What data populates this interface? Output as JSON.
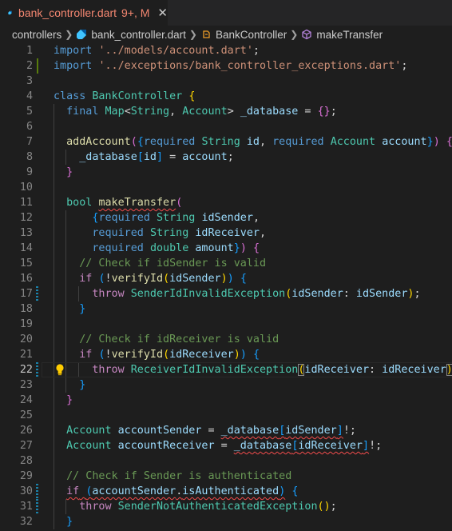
{
  "tab": {
    "filename": "bank_controller.dart",
    "badge": "9+, M",
    "close_glyph": "✕"
  },
  "breadcrumb": {
    "folder": "controllers",
    "file": "bank_controller.dart",
    "class": "BankController",
    "method": "makeTransfer"
  },
  "colors": {
    "tab_modified": "#f48771",
    "line_added": "#587c0c",
    "line_modified": "#1b81a8",
    "error_squiggle": "#f14c4c"
  },
  "editor": {
    "line_numbers": [
      "1",
      "2",
      "3",
      "4",
      "5",
      "6",
      "7",
      "8",
      "9",
      "10",
      "11",
      "12",
      "13",
      "14",
      "15",
      "16",
      "17",
      "18",
      "19",
      "20",
      "21",
      "22",
      "23",
      "24",
      "25",
      "26",
      "27",
      "28",
      "29",
      "30",
      "31",
      "32"
    ],
    "active_line": "22",
    "lines": [
      [
        [
          "kw",
          "import"
        ],
        [
          "pn",
          " "
        ],
        [
          "st",
          "'../models/account.dart'"
        ],
        [
          "pn",
          ";"
        ]
      ],
      [
        [
          "kw",
          "import"
        ],
        [
          "pn",
          " "
        ],
        [
          "st",
          "'../exceptions/bank_controller_exceptions.dart'"
        ],
        [
          "pn",
          ";"
        ]
      ],
      [],
      [
        [
          "kw",
          "class"
        ],
        [
          "pn",
          " "
        ],
        [
          "ty",
          "BankController"
        ],
        [
          "pn",
          " "
        ],
        [
          "b1",
          "{"
        ]
      ],
      [
        [
          "pn",
          "  "
        ],
        [
          "kw",
          "final"
        ],
        [
          "pn",
          " "
        ],
        [
          "ty",
          "Map"
        ],
        [
          "pn",
          "<"
        ],
        [
          "ty",
          "String"
        ],
        [
          "pn",
          ", "
        ],
        [
          "ty",
          "Account"
        ],
        [
          "pn",
          "> "
        ],
        [
          "vr",
          "_database"
        ],
        [
          "pn",
          " = "
        ],
        [
          "b2",
          "{}"
        ],
        [
          "pn",
          ";"
        ]
      ],
      [],
      [
        [
          "pn",
          "  "
        ],
        [
          "fn",
          "addAccount"
        ],
        [
          "b2",
          "("
        ],
        [
          "b3",
          "{"
        ],
        [
          "kw",
          "required"
        ],
        [
          "pn",
          " "
        ],
        [
          "ty",
          "String"
        ],
        [
          "pn",
          " "
        ],
        [
          "vr",
          "id"
        ],
        [
          "pn",
          ", "
        ],
        [
          "kw",
          "required"
        ],
        [
          "pn",
          " "
        ],
        [
          "ty",
          "Account"
        ],
        [
          "pn",
          " "
        ],
        [
          "vr",
          "account"
        ],
        [
          "b3",
          "}"
        ],
        [
          "b2",
          ")"
        ],
        [
          "pn",
          " "
        ],
        [
          "b2",
          "{"
        ]
      ],
      [
        [
          "pn",
          "    "
        ],
        [
          "vr",
          "_database"
        ],
        [
          "b3",
          "["
        ],
        [
          "vr",
          "id"
        ],
        [
          "b3",
          "]"
        ],
        [
          "pn",
          " = "
        ],
        [
          "vr",
          "account"
        ],
        [
          "pn",
          ";"
        ]
      ],
      [
        [
          "pn",
          "  "
        ],
        [
          "b2",
          "}"
        ]
      ],
      [],
      [
        [
          "pn",
          "  "
        ],
        [
          "ty",
          "bool"
        ],
        [
          "pn",
          " "
        ],
        [
          "fn:sq",
          "makeTransfer"
        ],
        [
          "b2",
          "("
        ]
      ],
      [
        [
          "pn",
          "      "
        ],
        [
          "b3",
          "{"
        ],
        [
          "kw",
          "required"
        ],
        [
          "pn",
          " "
        ],
        [
          "ty",
          "String"
        ],
        [
          "pn",
          " "
        ],
        [
          "vr",
          "idSender"
        ],
        [
          "pn",
          ","
        ]
      ],
      [
        [
          "pn",
          "      "
        ],
        [
          "kw",
          "required"
        ],
        [
          "pn",
          " "
        ],
        [
          "ty",
          "String"
        ],
        [
          "pn",
          " "
        ],
        [
          "vr",
          "idReceiver"
        ],
        [
          "pn",
          ","
        ]
      ],
      [
        [
          "pn",
          "      "
        ],
        [
          "kw",
          "required"
        ],
        [
          "pn",
          " "
        ],
        [
          "ty",
          "double"
        ],
        [
          "pn",
          " "
        ],
        [
          "vr",
          "amount"
        ],
        [
          "b3",
          "}"
        ],
        [
          "b2",
          ")"
        ],
        [
          "pn",
          " "
        ],
        [
          "b2",
          "{"
        ]
      ],
      [
        [
          "pn",
          "    "
        ],
        [
          "cm",
          "// Check if idSender is valid"
        ]
      ],
      [
        [
          "pn",
          "    "
        ],
        [
          "ct",
          "if"
        ],
        [
          "pn",
          " "
        ],
        [
          "b3",
          "("
        ],
        [
          "pn",
          "!"
        ],
        [
          "fn",
          "verifyId"
        ],
        [
          "b1",
          "("
        ],
        [
          "vr",
          "idSender"
        ],
        [
          "b1",
          ")"
        ],
        [
          "b3",
          ")"
        ],
        [
          "pn",
          " "
        ],
        [
          "b3",
          "{"
        ]
      ],
      [
        [
          "pn",
          "      "
        ],
        [
          "ct",
          "throw"
        ],
        [
          "pn",
          " "
        ],
        [
          "ty",
          "SenderIdInvalidException"
        ],
        [
          "b1",
          "("
        ],
        [
          "vr",
          "idSender"
        ],
        [
          "pn",
          ": "
        ],
        [
          "vr",
          "idSender"
        ],
        [
          "b1",
          ")"
        ],
        [
          "pn",
          ";"
        ]
      ],
      [
        [
          "pn",
          "    "
        ],
        [
          "b3",
          "}"
        ]
      ],
      [],
      [
        [
          "pn",
          "    "
        ],
        [
          "cm",
          "// Check if idReceiver is valid"
        ]
      ],
      [
        [
          "pn",
          "    "
        ],
        [
          "ct",
          "if"
        ],
        [
          "pn",
          " "
        ],
        [
          "b3",
          "("
        ],
        [
          "pn",
          "!"
        ],
        [
          "fn",
          "verifyId"
        ],
        [
          "b1",
          "("
        ],
        [
          "vr",
          "idReceiver"
        ],
        [
          "b1",
          ")"
        ],
        [
          "b3",
          ")"
        ],
        [
          "pn",
          " "
        ],
        [
          "b3",
          "{"
        ]
      ],
      [
        [
          "pn",
          "      "
        ],
        [
          "ct",
          "throw"
        ],
        [
          "pn",
          " "
        ],
        [
          "ty",
          "ReceiverIdInvalidException"
        ],
        [
          "b1:bm",
          "("
        ],
        [
          "vr",
          "idReceiver"
        ],
        [
          "pn",
          ": "
        ],
        [
          "vr",
          "idReceiver"
        ],
        [
          "b1:bm",
          ")"
        ],
        [
          "pn",
          ";"
        ]
      ],
      [
        [
          "pn",
          "    "
        ],
        [
          "b3",
          "}"
        ]
      ],
      [
        [
          "pn",
          "  "
        ],
        [
          "b2",
          "}"
        ]
      ],
      [],
      [
        [
          "pn",
          "  "
        ],
        [
          "ty",
          "Account"
        ],
        [
          "pn",
          " "
        ],
        [
          "vr",
          "accountSender"
        ],
        [
          "pn",
          " = "
        ],
        [
          "vr:sq",
          "_database"
        ],
        [
          "b3:sq",
          "["
        ],
        [
          "vr:sq",
          "idSender"
        ],
        [
          "b3:sq",
          "]"
        ],
        [
          "pn",
          "!;"
        ]
      ],
      [
        [
          "pn",
          "  "
        ],
        [
          "ty",
          "Account"
        ],
        [
          "pn",
          " "
        ],
        [
          "vr",
          "accountReceiver"
        ],
        [
          "pn",
          " = "
        ],
        [
          "vr:sq",
          "_database"
        ],
        [
          "b3:sq",
          "["
        ],
        [
          "vr:sq",
          "idReceiver"
        ],
        [
          "b3:sq",
          "]"
        ],
        [
          "pn",
          "!;"
        ]
      ],
      [],
      [
        [
          "pn",
          "  "
        ],
        [
          "cm",
          "// Check if Sender is authenticated"
        ]
      ],
      [
        [
          "pn",
          "  "
        ],
        [
          "ct:sq",
          "if"
        ],
        [
          "pn:sq",
          " "
        ],
        [
          "b3:sq",
          "("
        ],
        [
          "vr:sq",
          "accountSender"
        ],
        [
          "pn:sq",
          "."
        ],
        [
          "vr:sq",
          "isAuthenticated"
        ],
        [
          "b3:sq",
          ")"
        ],
        [
          "pn",
          " "
        ],
        [
          "b3",
          "{"
        ]
      ],
      [
        [
          "pn",
          "    "
        ],
        [
          "ct",
          "throw"
        ],
        [
          "pn",
          " "
        ],
        [
          "ty",
          "SenderNotAuthenticatedException"
        ],
        [
          "b1",
          "()"
        ],
        [
          "pn",
          ";"
        ]
      ],
      [
        [
          "pn",
          "  "
        ],
        [
          "b3",
          "}"
        ]
      ]
    ],
    "gutter": {
      "2": "added",
      "17": "modified",
      "22": "modified",
      "30": "modified",
      "31": "modified"
    }
  }
}
